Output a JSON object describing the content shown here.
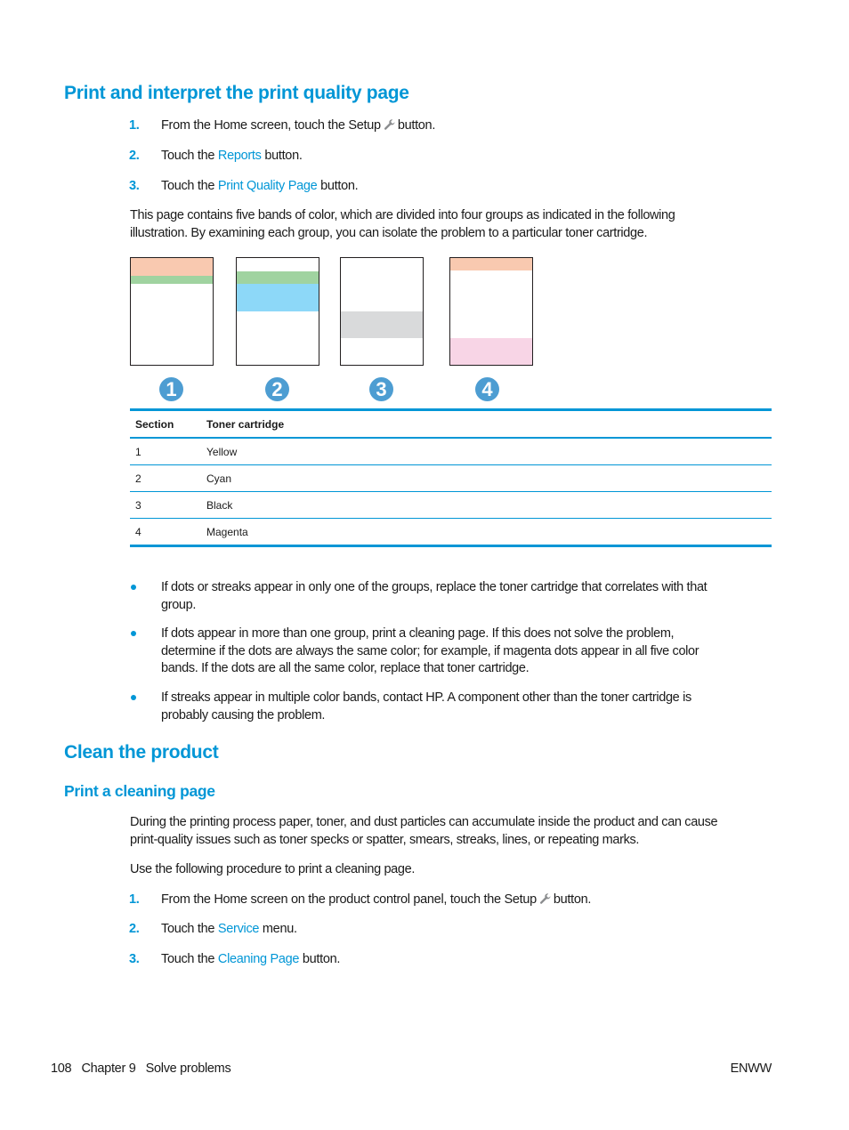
{
  "section1": {
    "title": "Print and interpret the print quality page",
    "steps": [
      {
        "num": "1.",
        "pre": "From the Home screen, touch the Setup",
        "link": "",
        "post": "button.",
        "icon": "wrench-icon"
      },
      {
        "num": "2.",
        "pre": "Touch the ",
        "link": "Reports",
        "post": " button."
      },
      {
        "num": "3.",
        "pre": "Touch the ",
        "link": "Print Quality Page",
        "post": " button."
      }
    ],
    "intro_lines": [
      "This page contains five bands of color, which are divided into four groups as indicated in the following",
      "illustration. By examining each group, you can isolate the problem to a particular toner cartridge."
    ],
    "illustration": {
      "groups": [
        {
          "label": "1",
          "bands": [
            {
              "color": "#f9c9b0"
            },
            {
              "color": "#a0d3a0"
            }
          ]
        },
        {
          "label": "2",
          "bands": [
            {
              "color": "#a0d3a0"
            },
            {
              "color": "#8dd8f8"
            }
          ]
        },
        {
          "label": "3",
          "bands": [
            {
              "color": "#d9dadb"
            }
          ]
        },
        {
          "label": "4",
          "bands": [
            {
              "color": "#f9c9b0"
            },
            {
              "color": "#f8d5e6"
            }
          ]
        }
      ],
      "badge_color": "#4d9dd2"
    },
    "table": {
      "headers": [
        "Section",
        "Toner cartridge"
      ],
      "rows": [
        [
          "1",
          "Yellow"
        ],
        [
          "2",
          "Cyan"
        ],
        [
          "3",
          "Black"
        ],
        [
          "4",
          "Magenta"
        ]
      ]
    },
    "bullets": [
      [
        "If dots or streaks appear in only one of the groups, replace the toner cartridge that correlates with that",
        "group."
      ],
      [
        "If dots appear in more than one group, print a cleaning page. If this does not solve the problem,",
        "determine if the dots are always the same color; for example, if magenta dots appear in all five color",
        "bands. If the dots are all the same color, replace that toner cartridge."
      ],
      [
        "If streaks appear in multiple color bands, contact HP. A component other than the toner cartridge is",
        "probably causing the problem."
      ]
    ]
  },
  "section2": {
    "title": "Clean the product",
    "subtitle": "Print a cleaning page",
    "para1_lines": [
      "During the printing process paper, toner, and dust particles can accumulate inside the product and can cause",
      "print-quality issues such as toner specks or spatter, smears, streaks, lines, or repeating marks."
    ],
    "para2": "Use the following procedure to print a cleaning page.",
    "steps": [
      {
        "num": "1.",
        "pre": "From the Home screen on the product control panel, touch the Setup",
        "link": "",
        "post": "button.",
        "icon": "wrench-icon"
      },
      {
        "num": "2.",
        "pre": "Touch the ",
        "link": "Service",
        "post": " menu."
      },
      {
        "num": "3.",
        "pre": "Touch the ",
        "link": "Cleaning Page",
        "post": " button."
      }
    ]
  },
  "footer": {
    "page_number": "108",
    "chapter": "Chapter 9",
    "chapter_title": "Solve problems",
    "right": "ENWW"
  },
  "colors": {
    "accent": "#0096d6",
    "text": "#1a1a1a"
  }
}
